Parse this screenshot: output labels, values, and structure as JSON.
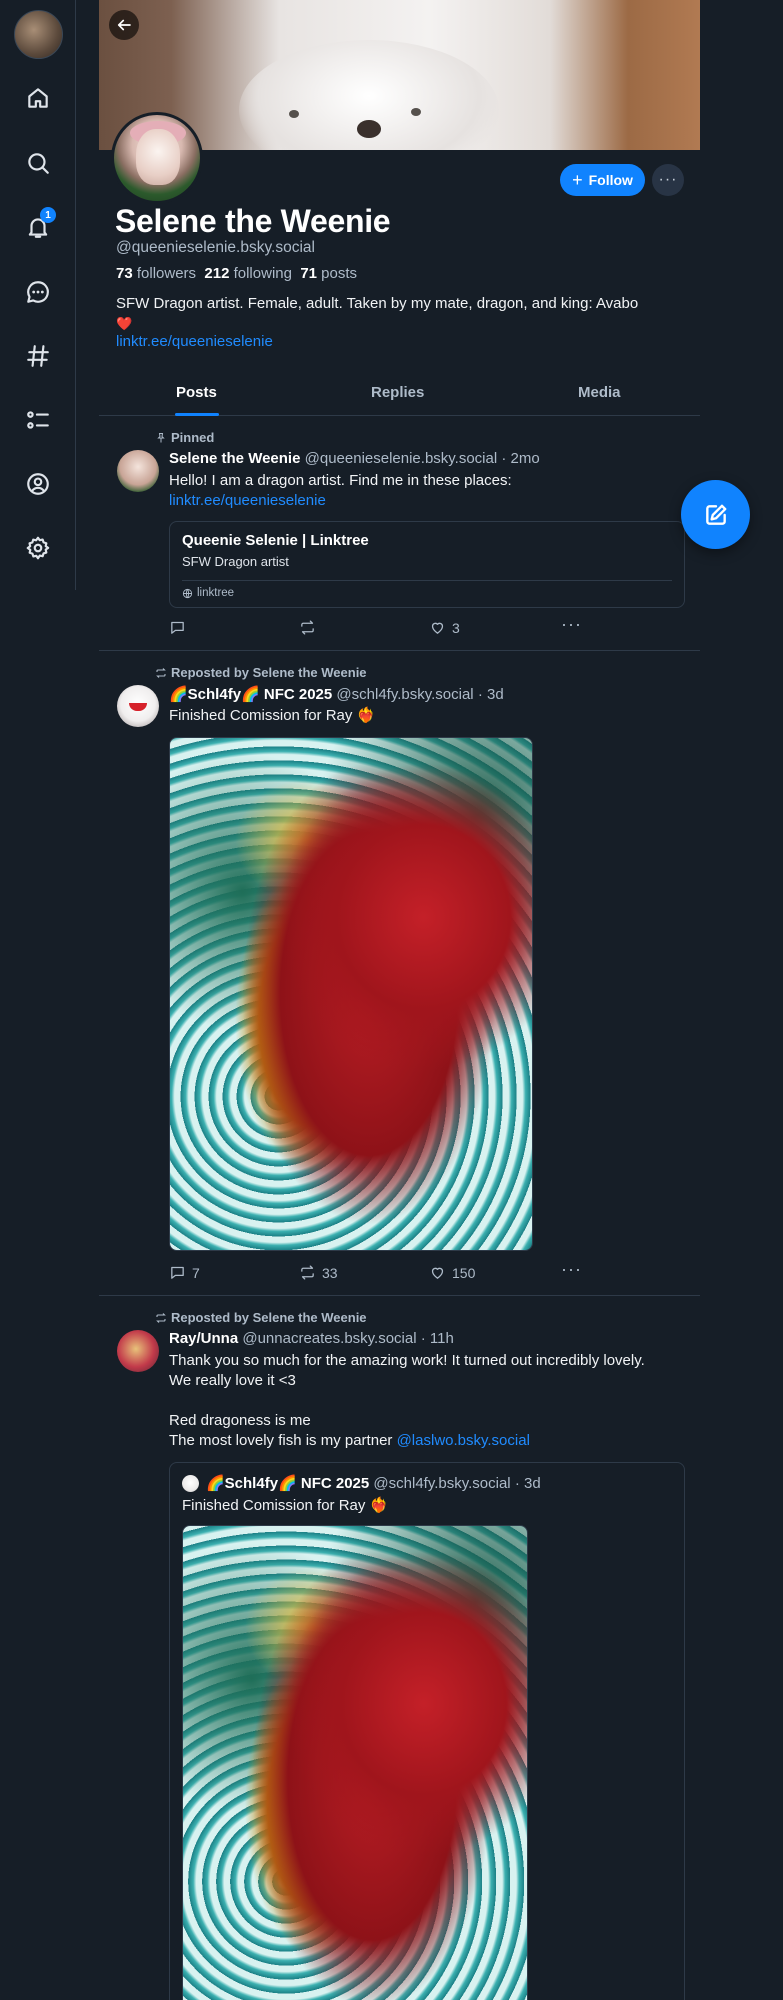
{
  "nav": {
    "notification_count": "1",
    "items": [
      {
        "name": "home"
      },
      {
        "name": "search"
      },
      {
        "name": "notifications"
      },
      {
        "name": "chat"
      },
      {
        "name": "feeds"
      },
      {
        "name": "lists"
      },
      {
        "name": "profile"
      },
      {
        "name": "settings"
      }
    ]
  },
  "profile": {
    "display_name": "Selene the Weenie",
    "handle": "@queenieselenie.bsky.social",
    "followers_count": "73",
    "followers_label": "followers",
    "following_count": "212",
    "following_label": "following",
    "posts_count": "71",
    "posts_label": "posts",
    "bio": "SFW Dragon artist. Female, adult. Taken by my mate, dragon, and king: Avabo",
    "bio_heart": "❤️",
    "bio_link": "linktr.ee/queenieselenie",
    "follow_label": "Follow",
    "more_label": "···"
  },
  "tabs": [
    {
      "label": "Posts",
      "active": true
    },
    {
      "label": "Replies",
      "active": false
    },
    {
      "label": "Media",
      "active": false
    }
  ],
  "posts": [
    {
      "context": "Pinned",
      "author": "Selene the Weenie",
      "handle": "@queenieselenie.bsky.social",
      "time": "· 2mo",
      "text": "Hello! I am a dragon artist. Find me in these places:",
      "link": "linktr.ee/queenieselenie",
      "card": {
        "title": "Queenie Selenie | Linktree",
        "description": "SFW Dragon artist",
        "domain": "linktree"
      },
      "replies": "",
      "reposts": "",
      "likes": "3"
    },
    {
      "context": "Reposted by Selene the Weenie",
      "author": "🌈Schl4fy🌈 NFC 2025",
      "handle": "@schl4fy.bsky.social",
      "time": "· 3d",
      "text": "Finished Comission for Ray ❤️‍🔥",
      "replies": "7",
      "reposts": "33",
      "likes": "150"
    },
    {
      "context": "Reposted by Selene the Weenie",
      "author": "Ray/Unna",
      "handle": "@unnacreates.bsky.social",
      "time": "· 11h",
      "text_line1": "Thank you so much for the amazing work! It turned out incredibly lovely.",
      "text_line2": "We really love it <3",
      "text_line3": "Red dragoness is me",
      "text_line4": "The most lovely fish is my partner",
      "mention": "@laslwo.bsky.social",
      "quote": {
        "author": "🌈Schl4fy🌈 NFC 2025",
        "handle": "@schl4fy.bsky.social",
        "time": "· 3d",
        "text": "Finished Comission for Ray ❤️‍🔥"
      }
    }
  ],
  "colors": {
    "accent": "#1083fe",
    "background": "#161e27",
    "border": "#2e3a48",
    "muted": "#aebbc9",
    "like_heart": "#e01e32"
  }
}
